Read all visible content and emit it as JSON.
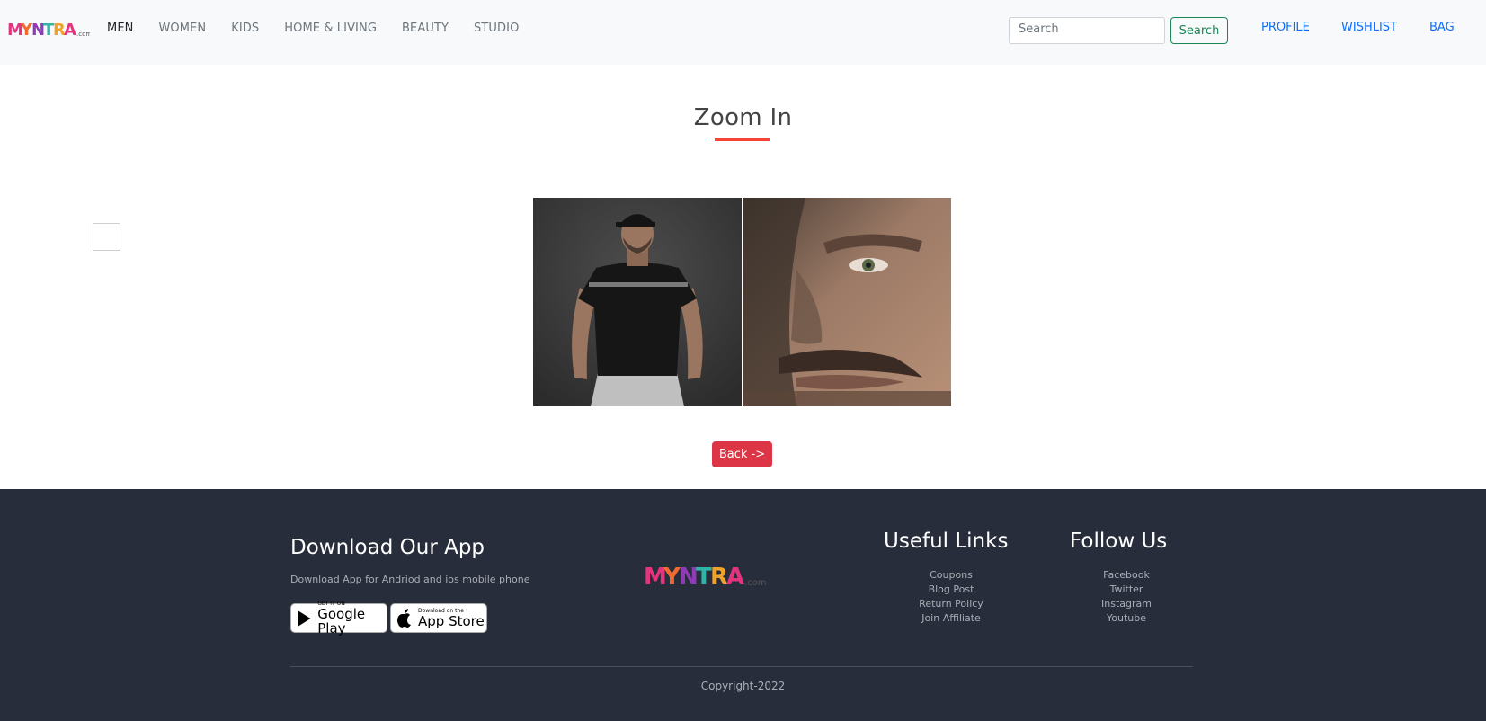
{
  "navbar": {
    "brand": "Myntra",
    "brand_suffix": ".com",
    "links": [
      "MEN",
      "WOMEN",
      "KIDS",
      "HOME & LIVING",
      "BEAUTY",
      "STUDIO"
    ],
    "search_placeholder": "Search",
    "search_button": "Search",
    "profile": "PROFILE",
    "wishlist": "WISHLIST",
    "bag": "BAG"
  },
  "main": {
    "title": "Zoom In",
    "back_button": "Back ->"
  },
  "footer": {
    "app_title": "Download Our App",
    "app_desc": "Download App for Andriod and ios mobile phone",
    "google_play_small": "GET IT ON",
    "google_play_big": "Google Play",
    "app_store_small": "Download on the",
    "app_store_big": "App Store",
    "useful_links_title": "Useful Links",
    "useful_links": [
      "Coupons",
      "Blog Post",
      "Return Policy",
      "Join Affiliate"
    ],
    "follow_title": "Follow Us",
    "follow_links": [
      "Facebook",
      "Twitter",
      "Instagram",
      "Youtube"
    ],
    "copyright": "Copyright-2022"
  },
  "colors": {
    "accent_red": "#dc3545",
    "underline": "#f54334",
    "link_blue": "#0d6efd",
    "search_green": "#198754",
    "footer_bg": "#282d3b"
  }
}
